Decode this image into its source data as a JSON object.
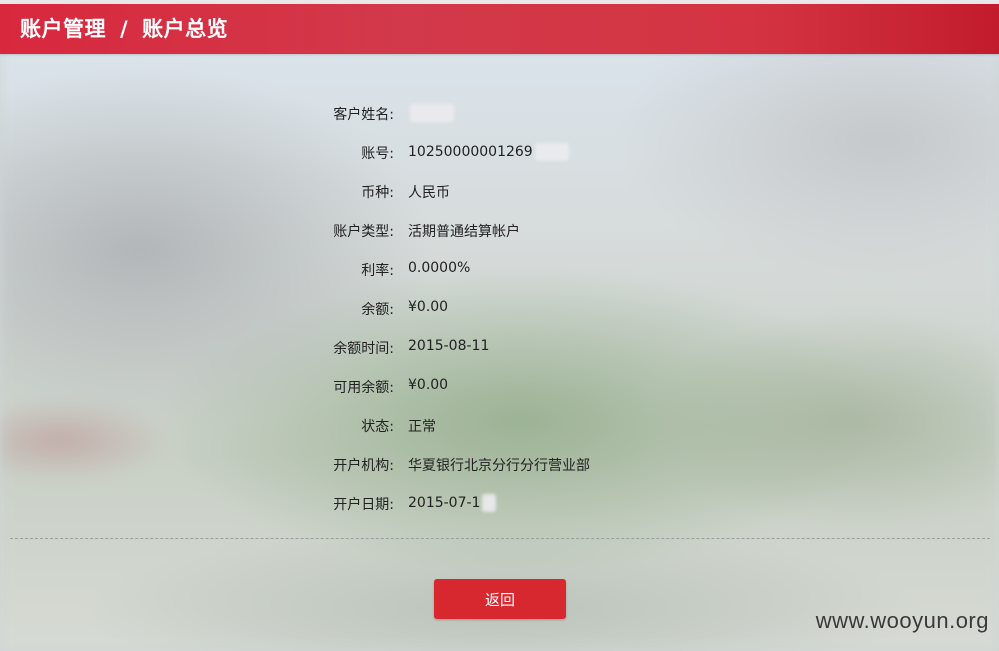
{
  "header": {
    "section": "账户管理",
    "separator": "/",
    "page": "账户总览"
  },
  "fields": [
    {
      "label": "客户姓名:",
      "value": ""
    },
    {
      "label": "账号:",
      "value": "10250000001269"
    },
    {
      "label": "币种:",
      "value": "人民币"
    },
    {
      "label": "账户类型:",
      "value": "活期普通结算帐户"
    },
    {
      "label": "利率:",
      "value": "0.0000%"
    },
    {
      "label": "余额:",
      "value": "¥0.00"
    },
    {
      "label": "余额时间:",
      "value": "2015-08-11"
    },
    {
      "label": "可用余额:",
      "value": "¥0.00"
    },
    {
      "label": "状态:",
      "value": "正常"
    },
    {
      "label": "开户机构:",
      "value": "华夏银行北京分行分行营业部"
    },
    {
      "label": "开户日期:",
      "value": "2015-07-1"
    }
  ],
  "back_button": {
    "label": "返回"
  },
  "watermark": "www.wooyun.org"
}
